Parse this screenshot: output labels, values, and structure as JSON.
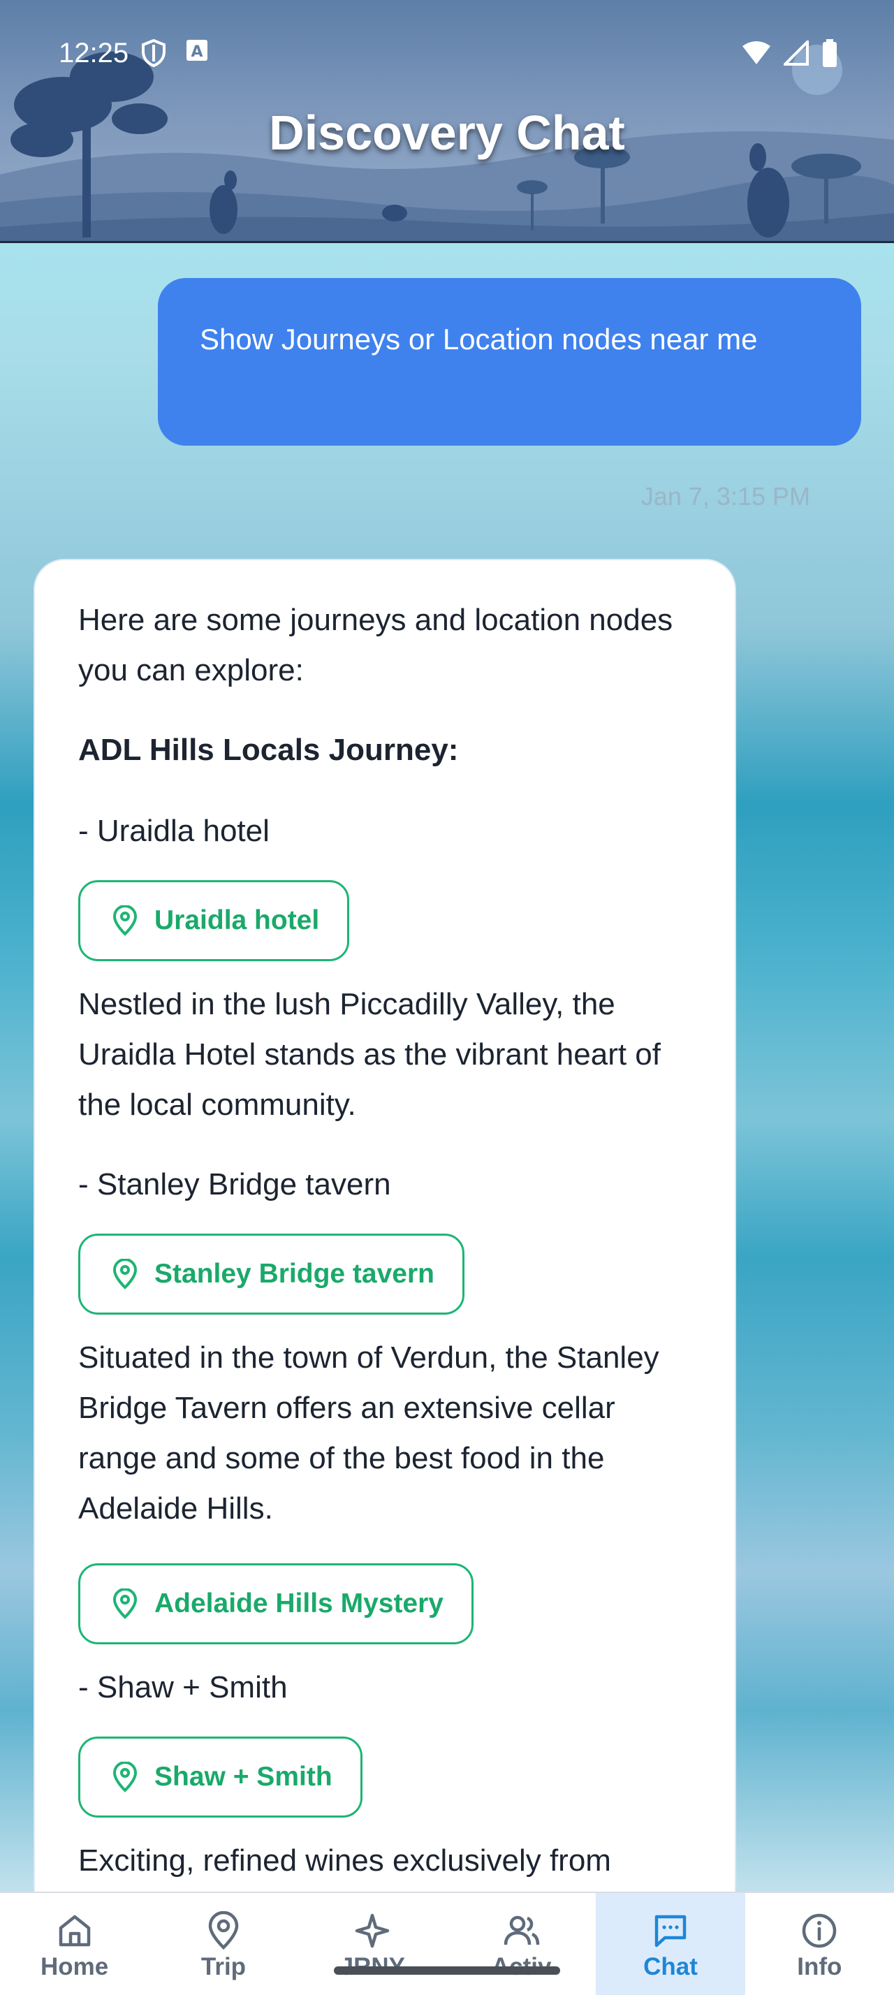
{
  "status_bar": {
    "time": "12:25",
    "icons": [
      "shield-icon",
      "notification-a-icon",
      "wifi-icon",
      "signal-icon",
      "battery-icon"
    ]
  },
  "header": {
    "title": "Discovery Chat"
  },
  "chat": {
    "user_message": "Show Journeys or Location nodes near me",
    "timestamp": "Jan 7, 3:15 PM",
    "bot": {
      "intro": "Here are some journeys and location nodes you can explore:",
      "journey_heading": "ADL Hills Locals Journey:",
      "item1_text": " - Uraidla hotel",
      "item1_chip": "Uraidla hotel",
      "item1_desc": "Nestled in the lush Piccadilly Valley, the Uraidla Hotel stands as the vibrant heart of the local community.",
      "item2_text": " - Stanley Bridge tavern",
      "item2_chip": "Stanley Bridge tavern",
      "item2_desc": "Situated in the town of Verdun, the Stanley Bridge Tavern offers an extensive cellar range and some of the best food in the Adelaide Hills.",
      "item3_chip": "Adelaide Hills Mystery",
      "item4_text": " - Shaw + Smith",
      "item4_chip": "Shaw + Smith",
      "item4_desc": "Exciting, refined wines exclusively from"
    }
  },
  "bottom_nav": {
    "items": [
      {
        "label": "Home",
        "icon": "home-icon"
      },
      {
        "label": "Trip",
        "icon": "map-pin-icon"
      },
      {
        "label": "JRNY",
        "icon": "sparkle-icon"
      },
      {
        "label": "Activ",
        "icon": "users-icon"
      },
      {
        "label": "Chat",
        "icon": "chat-icon",
        "active": true
      },
      {
        "label": "Info",
        "icon": "info-icon"
      }
    ]
  },
  "colors": {
    "user_bubble": "#3f82ee",
    "chip_accent": "#1db574",
    "nav_active_bg": "#dcebfb",
    "nav_active_text": "#1e86d8"
  }
}
